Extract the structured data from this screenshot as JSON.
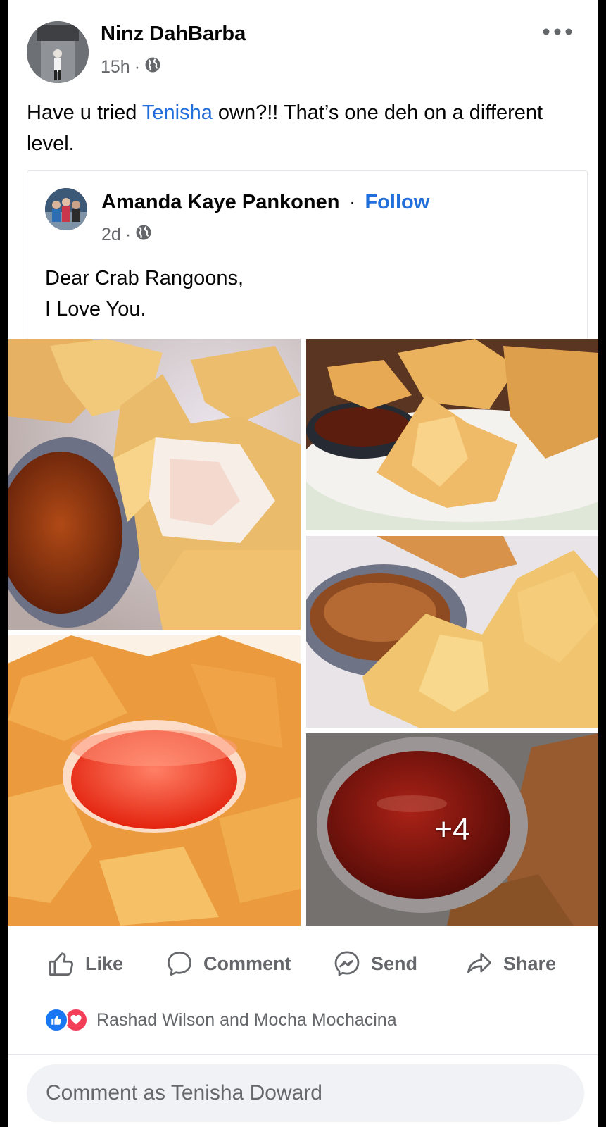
{
  "post": {
    "author": "Ninz DahBarba",
    "time": "15h",
    "text_before": "Have u tried ",
    "mention": "Tenisha",
    "text_after": " own?!! That’s one deh on a different level."
  },
  "shared": {
    "author": "Amanda Kaye Pankonen",
    "separator": "·",
    "follow_label": "Follow",
    "time": "2d",
    "text_line1": "Dear Crab Rangoons,",
    "text_line2": "I Love You."
  },
  "photos": {
    "more_count": "+4"
  },
  "actions": {
    "like": "Like",
    "comment": "Comment",
    "send": "Send",
    "share": "Share"
  },
  "reactions": {
    "names": "Rashad Wilson and Mocha Mochacina"
  },
  "comment_input": {
    "placeholder": "Comment as Tenisha Doward"
  },
  "colors": {
    "link_blue": "#216fdb",
    "like_blue": "#1877f2",
    "love_red": "#f33e58",
    "secondary_text": "#65676b"
  },
  "icons": [
    "globe-icon",
    "more-icon",
    "like-icon",
    "comment-icon",
    "messenger-icon",
    "share-icon"
  ]
}
